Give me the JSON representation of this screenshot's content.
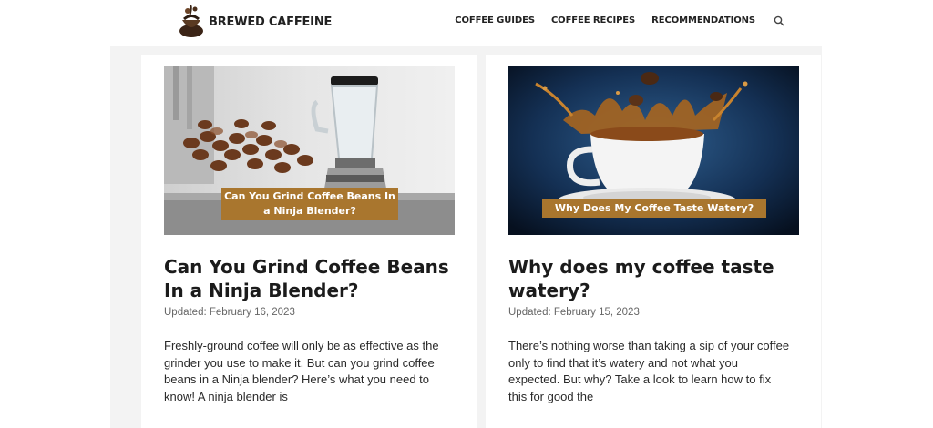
{
  "site": {
    "name": "BREWED CAFFEINE"
  },
  "nav": {
    "items": [
      "COFFEE GUIDES",
      "COFFEE RECIPES",
      "RECOMMENDATIONS"
    ]
  },
  "posts": [
    {
      "image_caption": "Can You Grind Coffee Beans In a Ninja Blender?",
      "title": "Can You Grind Coffee Beans In a Ninja Blender?",
      "date": "Updated: February 16, 2023",
      "excerpt": "Freshly-ground coffee will only be as effective as the grinder you use to make it. But can you grind coffee beans in a Ninja blender? Here’s what you need to know! A ninja blender is"
    },
    {
      "image_caption": "Why Does My Coffee Taste Watery?",
      "title": "Why does my coffee taste watery?",
      "date": "Updated: February 15, 2023",
      "excerpt": "There’s nothing worse than taking a sip of your coffee only to find that it’s watery and not what you expected. But why? Take a look to learn how to fix this for good the"
    }
  ]
}
